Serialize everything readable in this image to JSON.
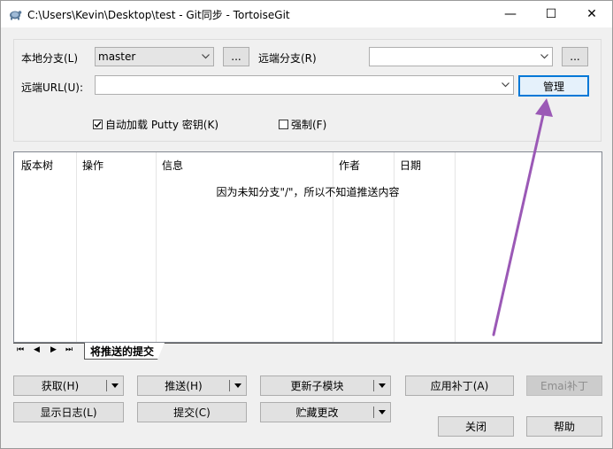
{
  "window": {
    "title": "C:\\Users\\Kevin\\Desktop\\test - Git同步 - TortoiseGit",
    "minimize": "—",
    "maximize": "☐",
    "close": "✕"
  },
  "form": {
    "local_branch_label": "本地分支(L)",
    "local_branch_value": "master",
    "local_browse": "...",
    "remote_branch_label": "远端分支(R)",
    "remote_branch_value": "",
    "remote_browse": "...",
    "remote_url_label": "远端URL(U):",
    "remote_url_value": "",
    "manage_label": "管理",
    "autoload_putty_label": "自动加载 Putty 密钥(K)",
    "autoload_putty_checked": true,
    "force_label": "强制(F)",
    "force_checked": false
  },
  "list": {
    "columns": [
      "版本树",
      "操作",
      "信息",
      "作者",
      "日期"
    ],
    "empty_message": "因为未知分支\"/\"，所以不知道推送内容"
  },
  "tabs": {
    "nav_first": "⏮",
    "nav_prev": "◀",
    "nav_next": "▶",
    "nav_last": "⏭",
    "active_tab": "将推送的提交"
  },
  "buttons": {
    "fetch": "获取(H)",
    "push": "推送(H)",
    "update_submodules": "更新子模块",
    "apply_patch": "应用补丁(A)",
    "email_patch": "Emai补丁",
    "show_log": "显示日志(L)",
    "commit": "提交(C)",
    "stash": "贮藏更改",
    "close": "关闭",
    "help": "帮助"
  },
  "colors": {
    "annotation_arrow": "#9b59b6",
    "focus_border": "#0078d7"
  }
}
